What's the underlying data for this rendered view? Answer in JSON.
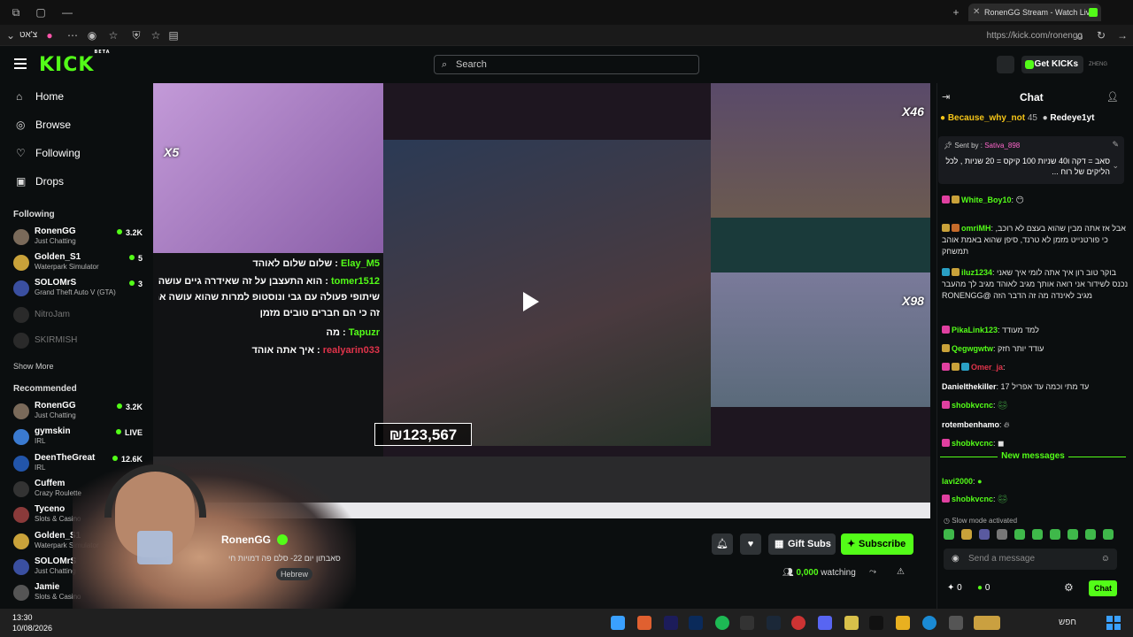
{
  "browser": {
    "tab_title": "RonenGG Stream - Watch Live",
    "url": "https://kick.com/ronengg",
    "locale_label": "צ'אט"
  },
  "header": {
    "logo": "KICK",
    "logo_badge": "BETA",
    "search_placeholder": "Search",
    "get_kicks": "Get KICKs",
    "avatar_label": "ZHENG"
  },
  "sidebar": {
    "nav": [
      {
        "label": "Home",
        "icon": "home-icon"
      },
      {
        "label": "Browse",
        "icon": "compass-icon"
      },
      {
        "label": "Following",
        "icon": "heart-icon"
      },
      {
        "label": "Drops",
        "icon": "gift-icon"
      }
    ],
    "following_title": "Following",
    "following": [
      {
        "name": "RonenGG",
        "game": "Just Chatting",
        "viewers": "3.2K",
        "live": true
      },
      {
        "name": "Golden_S1",
        "game": "Waterpark Simulator",
        "viewers": "5",
        "live": true
      },
      {
        "name": "SOLOMrS",
        "game": "Grand Theft Auto V (GTA)",
        "viewers": "3",
        "live": true
      },
      {
        "name": "NitroJam",
        "game": "",
        "viewers": "",
        "live": false
      },
      {
        "name": "SKIRMISH",
        "game": "",
        "viewers": "",
        "live": false
      }
    ],
    "show_more": "Show More",
    "recommended_title": "Recommended",
    "recommended": [
      {
        "name": "RonenGG",
        "game": "Just Chatting",
        "viewers": "3.2K"
      },
      {
        "name": "gymskin",
        "game": "IRL",
        "viewers": "LIVE"
      },
      {
        "name": "DeenTheGreat",
        "game": "IRL",
        "viewers": "12.6K"
      },
      {
        "name": "Cuffem",
        "game": "Crazy Roulette",
        "viewers": ""
      },
      {
        "name": "Tyceno",
        "game": "Slots & Casino",
        "viewers": ""
      },
      {
        "name": "Golden_S1",
        "game": "Waterpark Simulator",
        "viewers": ""
      },
      {
        "name": "SOLOMrS",
        "game": "Just Chatting",
        "viewers": ""
      },
      {
        "name": "Jamie",
        "game": "Slots & Casino",
        "viewers": ""
      }
    ]
  },
  "video": {
    "overlay_chat": [
      {
        "user": "Elay_M5",
        "text": "שלום שלום לאוהד",
        "color": "#53fc18"
      },
      {
        "user": "tomer1512",
        "text": "הוא התעצבן על זה שאידרה גיים עושה",
        "color": "#53fc18"
      },
      {
        "user": "",
        "text": "שיתופי פעולה עם גבי ונוסטופ למרות שהוא עושה את",
        "color": "#ffffff"
      },
      {
        "user": "",
        "text": "זה כי הם חברים טובים מזמן",
        "color": "#ffffff"
      },
      {
        "user": "Tapuzr",
        "text": "מה",
        "color": "#53fc18"
      },
      {
        "user": "realyarin033",
        "text": "איך אתה אוהד",
        "color": "#e0334a"
      }
    ],
    "kicks_counter": "₪123,567",
    "multipliers": [
      "X5",
      "X46",
      "X98"
    ]
  },
  "stream": {
    "name": "RonenGG",
    "title": "סאבתון יום 22- סלם פה דמויות חי",
    "tag": "Hebrew",
    "watching": "0,000",
    "watching_label": "watching",
    "gift_subs": "Gift Subs",
    "subscribe": "Subscribe"
  },
  "chat": {
    "title": "Chat",
    "top_gifters": [
      {
        "name": "Because_why_not",
        "count": "45"
      },
      {
        "name": "Redeye1yt",
        "count": ""
      }
    ],
    "pinned": {
      "sent_by_label": "Sent by",
      "user": "Sativa_898",
      "text": "סאב = דקה ו40 שניות 100 קיקס = 20 שניות , לכל הליקים של רוח ..."
    },
    "messages": [
      {
        "user": "White_Boy10",
        "text": "",
        "color": "#53fc18"
      },
      {
        "user": "omriMH",
        "text": "אבל אז אתה מבין שהוא בעצם לא רוכב, כי פורטנייט מזמן לא טרנד, סיפן שהוא באמת אוהב תמשחק",
        "color": "#53fc18"
      },
      {
        "user": "iluz1234",
        "text": "בוקר טוב רון איך אתה לומי איך שאני נכנס לשידור אני רואה אותך מגיב לאוהד מגיב לך מהעבר מגיב לאינדה מה זה הדבר הזה @RONENGG",
        "color": "#53fc18"
      },
      {
        "user": "PikaLink123",
        "text": "למד מעודד",
        "color": "#53fc18"
      },
      {
        "user": "Qegwgwtw",
        "text": "עודד יותר חזק",
        "color": "#53fc18"
      },
      {
        "user": "Omer_ja",
        "text": "",
        "color": "#e0334a"
      },
      {
        "user": "Danielthekiller",
        "text": "עד מתי וכמה עד אפריל 17",
        "color": "#ffffff"
      },
      {
        "user": "shobkvcnc",
        "text": "",
        "color": "#53fc18"
      },
      {
        "user": "rotembenhamo",
        "text": "",
        "color": "#ffffff"
      },
      {
        "user": "shobkvcnc",
        "text": "",
        "color": "#53fc18"
      }
    ],
    "new_messages": "New messages",
    "after_new": [
      {
        "user": "lavi2000",
        "text": "",
        "color": "#53fc18"
      },
      {
        "user": "shobkvcnc",
        "text": "",
        "color": "#53fc18"
      }
    ],
    "slow_mode": "Slow mode activated",
    "input_placeholder": "Send a message",
    "footer_a": "0",
    "footer_b": "0",
    "send": "Chat"
  },
  "taskbar": {
    "time": "13:30",
    "date": "10/08/2026",
    "search": "חפש"
  },
  "colors": {
    "accent": "#53fc18",
    "bg": "#0b0e0f"
  }
}
